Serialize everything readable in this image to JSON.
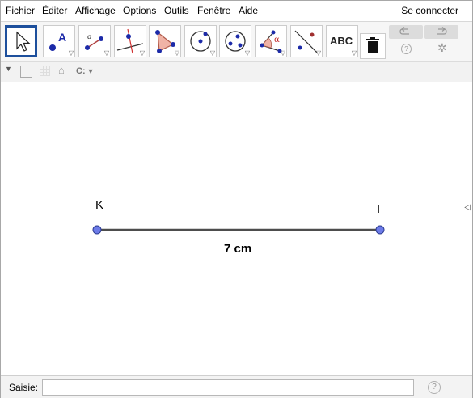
{
  "menu": {
    "items": [
      "Fichier",
      "Éditer",
      "Affichage",
      "Options",
      "Outils",
      "Fenêtre",
      "Aide"
    ],
    "signin": "Se connecter"
  },
  "toolbar": {
    "tools": [
      {
        "name": "move-tool",
        "glyph": "",
        "selected": true
      },
      {
        "name": "point-tool",
        "glyph": "A"
      },
      {
        "name": "segment-tool",
        "glyph": "a"
      },
      {
        "name": "perpendicular-line-tool",
        "glyph": ""
      },
      {
        "name": "polygon-tool",
        "glyph": ""
      },
      {
        "name": "circle-tool",
        "glyph": ""
      },
      {
        "name": "conic-tool",
        "glyph": ""
      },
      {
        "name": "angle-tool",
        "glyph": "α"
      },
      {
        "name": "reflect-tool",
        "glyph": ""
      },
      {
        "name": "text-tool",
        "glyph": "ABC"
      }
    ],
    "undo_icon": "undo-icon",
    "redo_icon": "redo-icon",
    "help_icon": "help-icon",
    "settings_icon": "gear-icon",
    "delete_icon": "trash-icon"
  },
  "stylebar": {
    "axes_icon": "axes-icon",
    "grid_icon": "grid-icon",
    "home_icon": "home-icon",
    "point_capture_label": "C:"
  },
  "graphics": {
    "point_color": "#6d7be8",
    "segment_color": "#4d4d4d",
    "points": [
      {
        "label": "K"
      },
      {
        "label": "I"
      }
    ],
    "segment_label": "7 cm"
  },
  "input": {
    "label": "Saisie:",
    "value": "",
    "help": "?"
  }
}
